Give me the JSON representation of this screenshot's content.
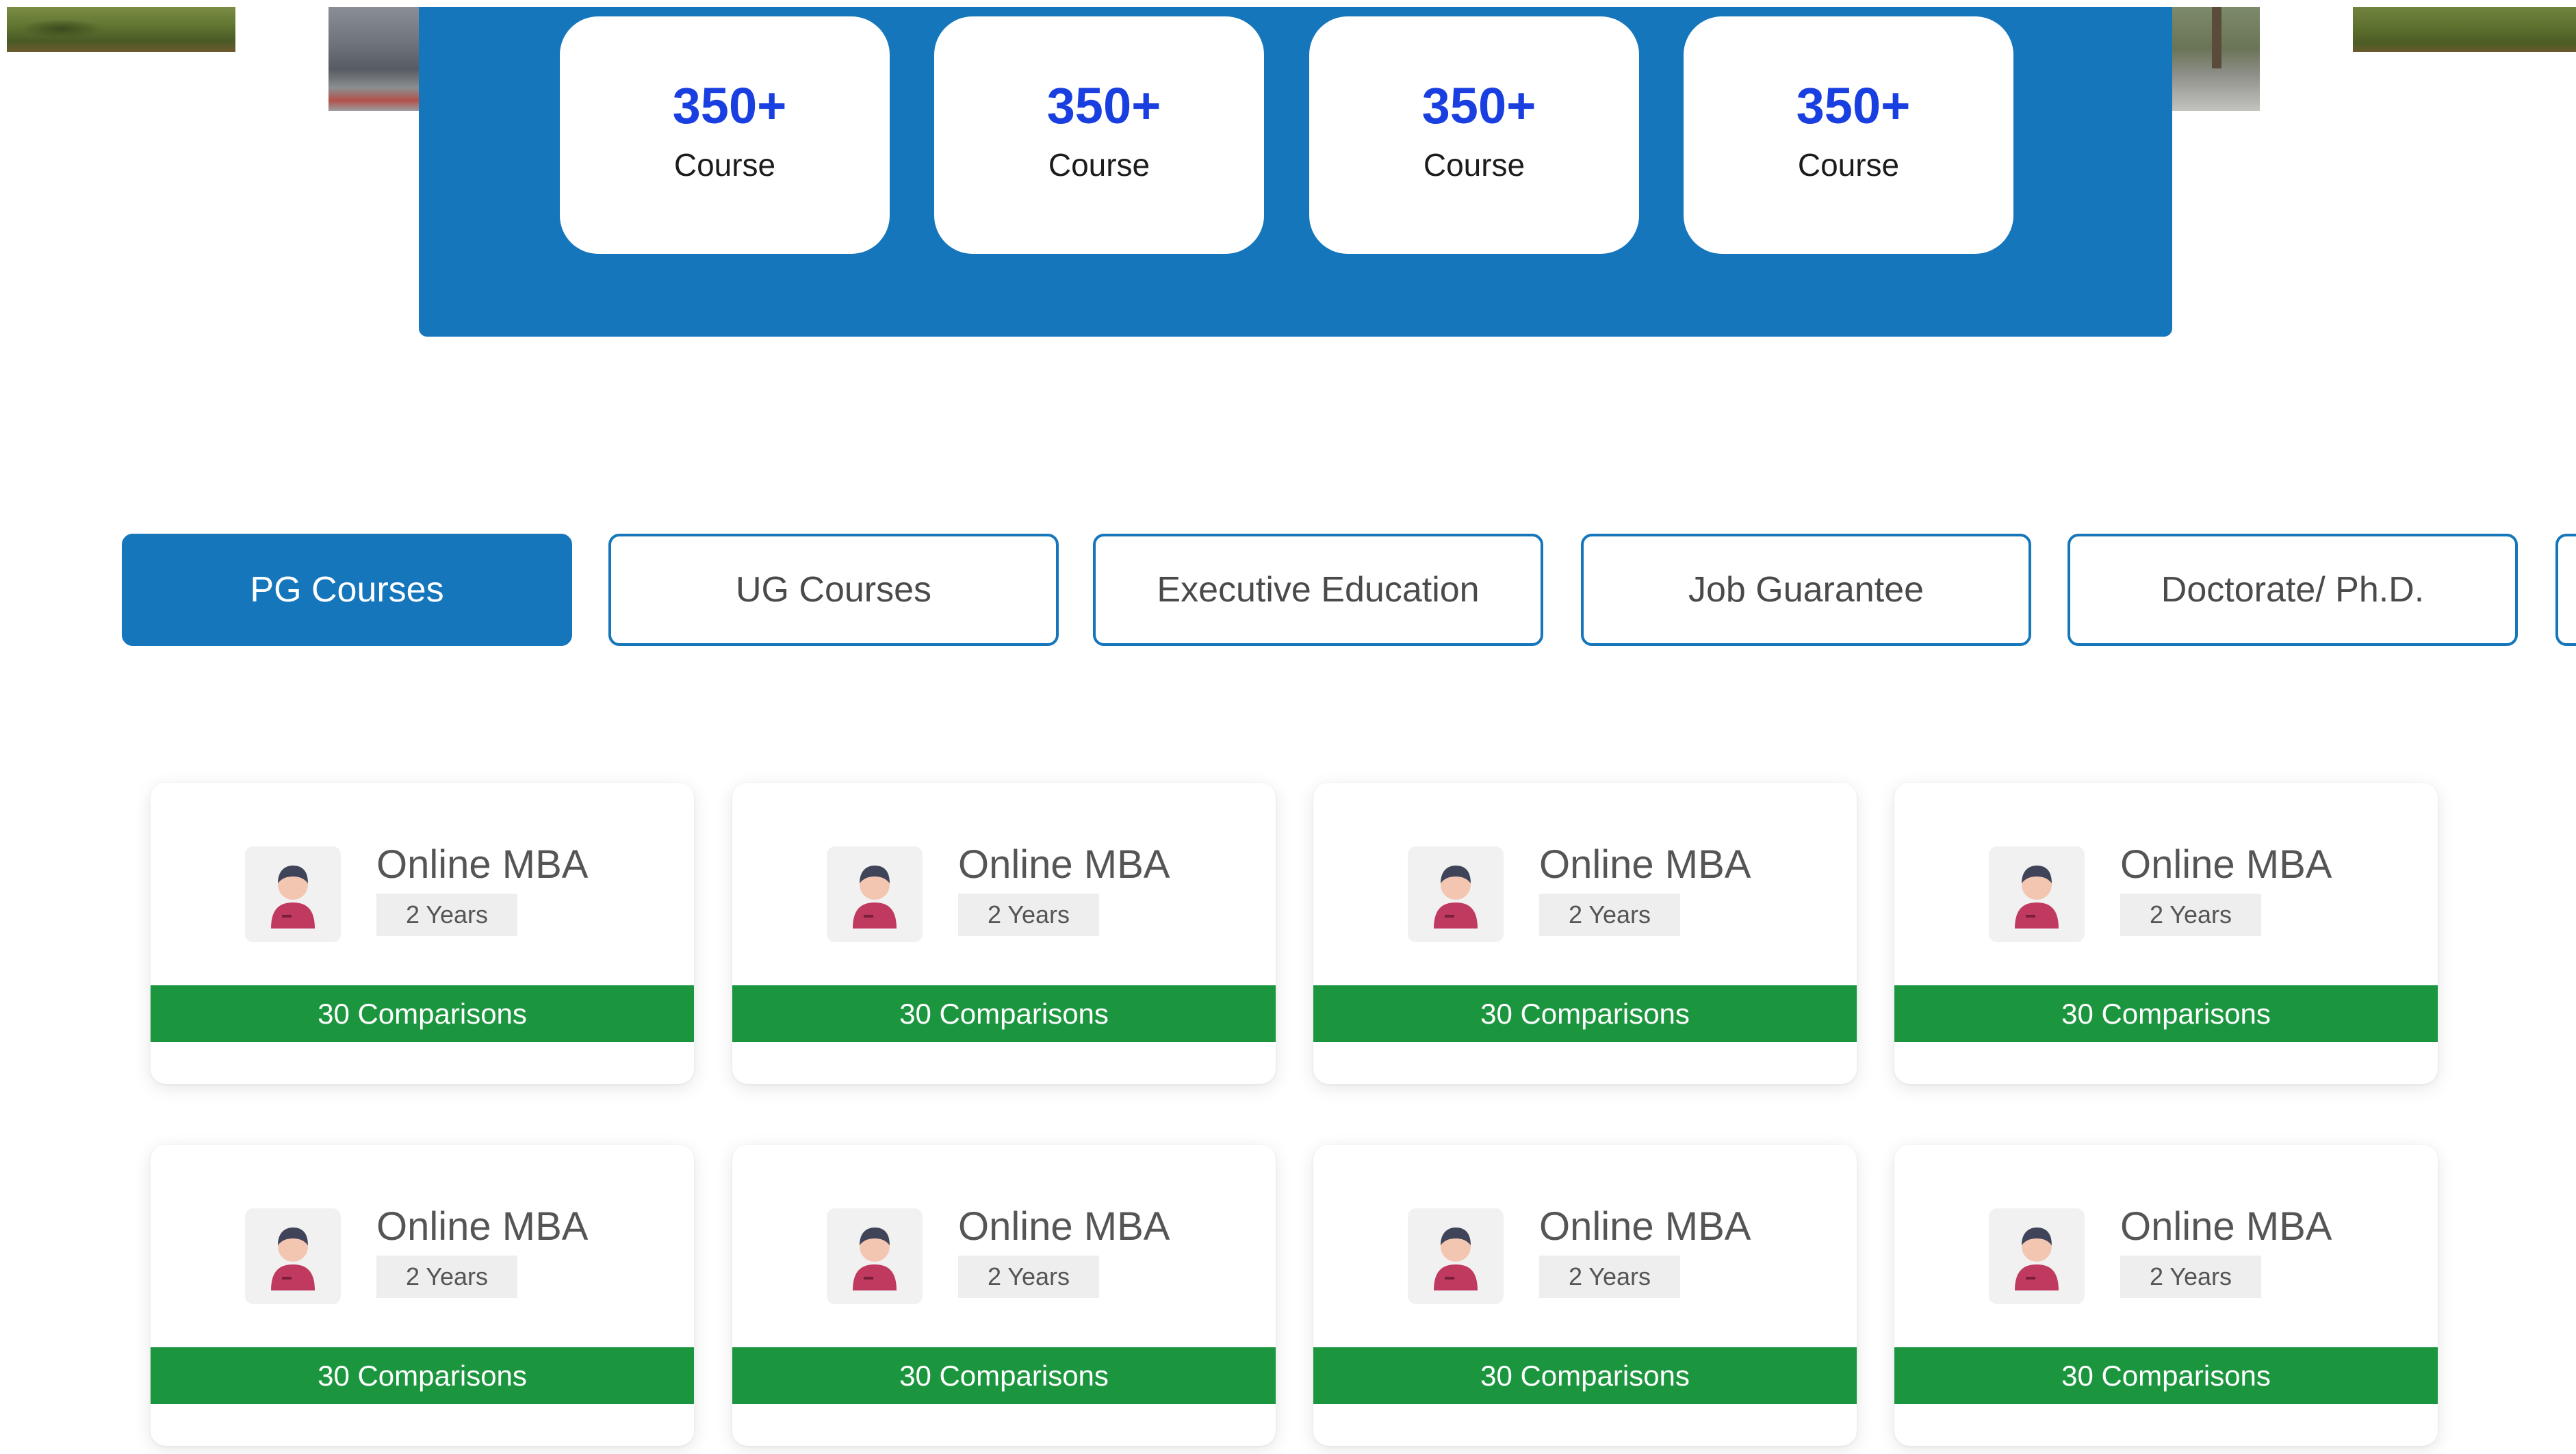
{
  "stats": [
    {
      "value": "350+",
      "label": "Course"
    },
    {
      "value": "350+",
      "label": "Course"
    },
    {
      "value": "350+",
      "label": "Course"
    },
    {
      "value": "350+",
      "label": "Course"
    }
  ],
  "tabs": [
    {
      "label": "PG Courses",
      "active": true
    },
    {
      "label": "UG Courses",
      "active": false
    },
    {
      "label": "Executive Education",
      "active": false
    },
    {
      "label": "Job Guarantee",
      "active": false
    },
    {
      "label": "Doctorate/ Ph.D.",
      "active": false
    }
  ],
  "courses": [
    {
      "title": "Online MBA",
      "duration": "2 Years",
      "comparisons": "30 Comparisons",
      "icon": "student-avatar-icon"
    },
    {
      "title": "Online MBA",
      "duration": "2 Years",
      "comparisons": "30 Comparisons",
      "icon": "student-avatar-icon"
    },
    {
      "title": "Online MBA",
      "duration": "2 Years",
      "comparisons": "30 Comparisons",
      "icon": "student-avatar-icon"
    },
    {
      "title": "Online MBA",
      "duration": "2 Years",
      "comparisons": "30 Comparisons",
      "icon": "student-avatar-icon"
    },
    {
      "title": "Online MBA",
      "duration": "2 Years",
      "comparisons": "30 Comparisons",
      "icon": "student-avatar-icon"
    },
    {
      "title": "Online MBA",
      "duration": "2 Years",
      "comparisons": "30 Comparisons",
      "icon": "student-avatar-icon"
    },
    {
      "title": "Online MBA",
      "duration": "2 Years",
      "comparisons": "30 Comparisons",
      "icon": "student-avatar-icon"
    },
    {
      "title": "Online MBA",
      "duration": "2 Years",
      "comparisons": "30 Comparisons",
      "icon": "student-avatar-icon"
    }
  ],
  "colors": {
    "primary_blue": "#1576bb",
    "stat_number_blue": "#1a3fe0",
    "comparison_green": "#1b963e",
    "avatar_shirt": "#c0395e",
    "avatar_hair": "#3f4458"
  }
}
